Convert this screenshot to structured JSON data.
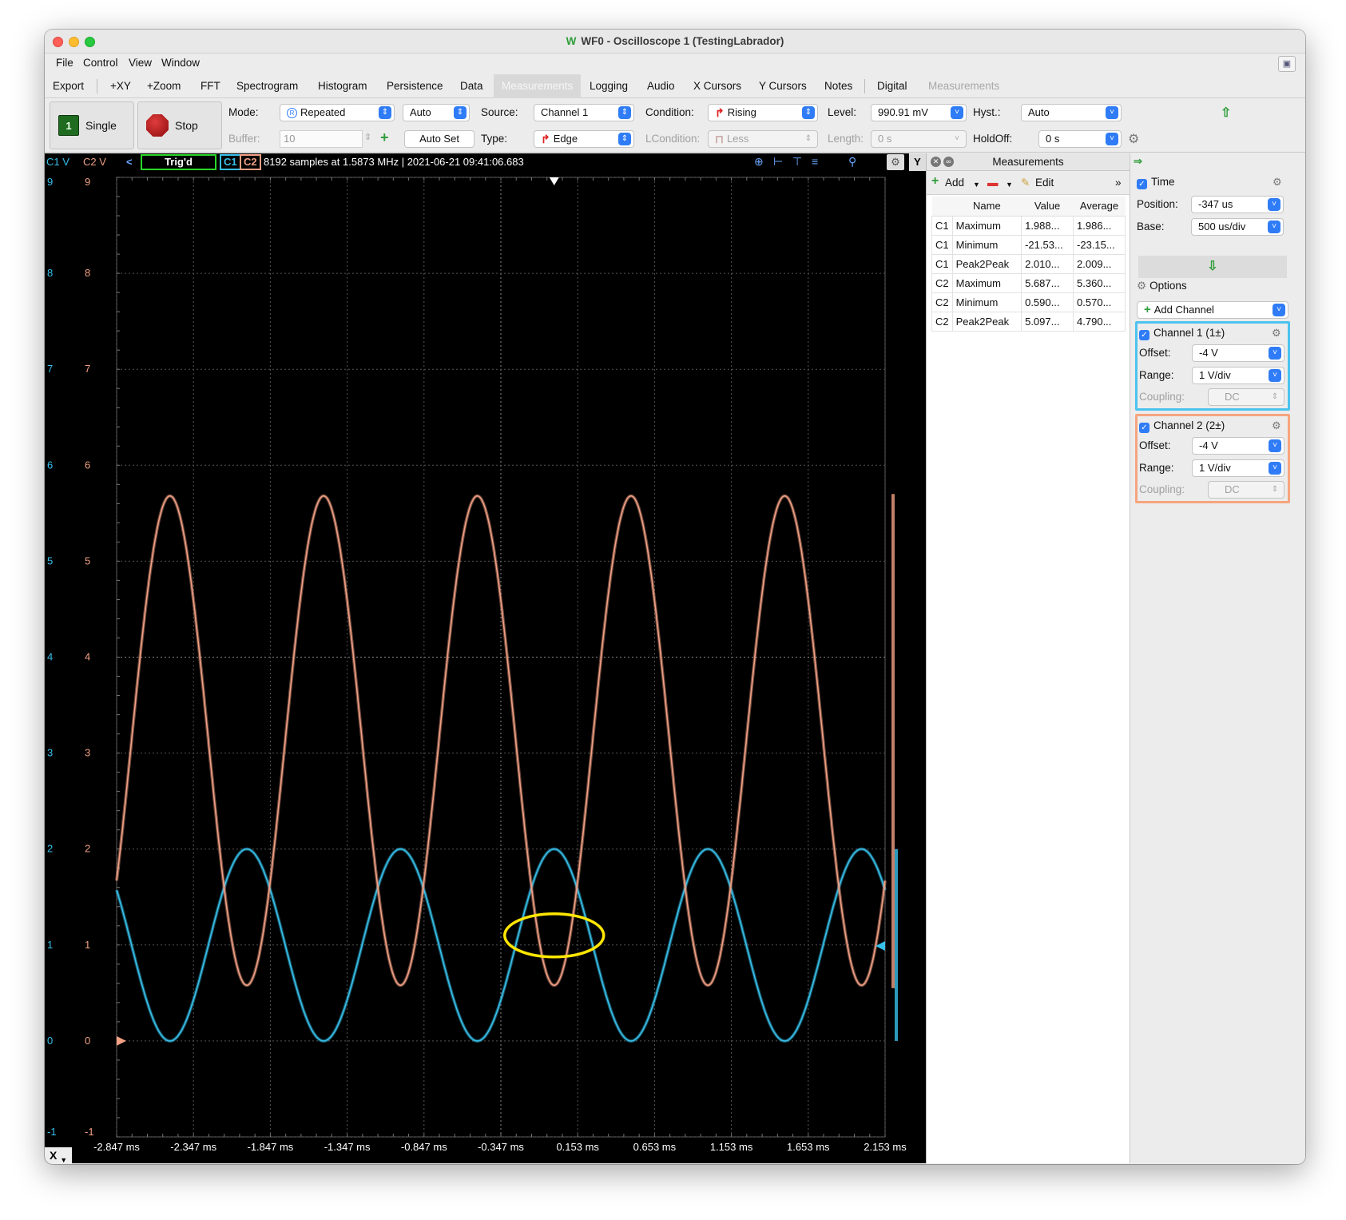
{
  "window": {
    "title": "WF0 - Oscilloscope 1 (TestingLabrador)",
    "logo": "W"
  },
  "menu": [
    "File",
    "Control",
    "View",
    "Window"
  ],
  "tabs": [
    {
      "label": "Export"
    },
    {
      "label": "+XY"
    },
    {
      "label": "+Zoom"
    },
    {
      "label": "FFT"
    },
    {
      "label": "Spectrogram"
    },
    {
      "label": "Histogram"
    },
    {
      "label": "Persistence"
    },
    {
      "label": "Data"
    },
    {
      "label": "Measurements",
      "active": true
    },
    {
      "label": "Logging"
    },
    {
      "label": "Audio"
    },
    {
      "label": "X Cursors"
    },
    {
      "label": "Y Cursors"
    },
    {
      "label": "Notes"
    },
    {
      "label": "Digital"
    },
    {
      "label": "Measurements",
      "disabled": true
    }
  ],
  "toolbar": {
    "single_label": "Single",
    "single_icon_text": "1",
    "stop_label": "Stop",
    "mode_label": "Mode:",
    "mode_value": "Repeated",
    "mode_icon": "R",
    "auto_value": "Auto",
    "source_label": "Source:",
    "source_value": "Channel 1",
    "condition_label": "Condition:",
    "condition_value": "Rising",
    "level_label": "Level:",
    "level_value": "990.91 mV",
    "hyst_label": "Hyst.:",
    "hyst_value": "Auto",
    "buffer_label": "Buffer:",
    "buffer_value": "10",
    "autoset_label": "Auto Set",
    "type_label": "Type:",
    "type_value": "Edge",
    "lcondition_label": "LCondition:",
    "lcondition_value": "Less",
    "length_label": "Length:",
    "length_value": "0 s",
    "holdoff_label": "HoldOff:",
    "holdoff_value": "0 s"
  },
  "scope": {
    "c1_axis_label": "C1 V",
    "c2_axis_label": "C2 V",
    "trig_status": "Trig'd",
    "c1_tag": "C1",
    "c2_tag": "C2",
    "info": "8192 samples at 1.5873 MHz | 2021-06-21 09:41:06.683",
    "y_button": "Y",
    "x_button": "X",
    "colors": {
      "c1": "#37c0ea",
      "c2": "#f1a084",
      "annotation": "#ffe600"
    }
  },
  "chart_data": {
    "type": "line",
    "x_ticks": [
      "-2.847 ms",
      "-2.347 ms",
      "-1.847 ms",
      "-1.347 ms",
      "-0.847 ms",
      "-0.347 ms",
      "0.153 ms",
      "0.653 ms",
      "1.153 ms",
      "1.653 ms",
      "2.153 ms"
    ],
    "xlim_ms": [
      -2.847,
      2.153
    ],
    "y_ticks": [
      9,
      8,
      7,
      6,
      5,
      4,
      3,
      2,
      1,
      0,
      -1
    ],
    "ylim": [
      -1,
      9
    ],
    "grid": true,
    "series": [
      {
        "name": "C1",
        "center": 1.0,
        "amplitude": 1.0,
        "period_ms": 1.0,
        "peak_at_ms": 0.0
      },
      {
        "name": "C2",
        "center": 3.13,
        "amplitude": 2.55,
        "period_ms": 1.0,
        "trough_at_ms": 0.0
      }
    ],
    "annotation": {
      "type": "ellipse",
      "center_ms": 0.0,
      "center_v": 1.1
    }
  },
  "measurements": {
    "title": "Measurements",
    "add_label": "Add",
    "edit_label": "Edit",
    "columns": [
      "",
      "Name",
      "Value",
      "Average"
    ],
    "rows": [
      [
        "C1",
        "Maximum",
        "1.988...",
        "1.986..."
      ],
      [
        "C1",
        "Minimum",
        "-21.53...",
        "-23.15..."
      ],
      [
        "C1",
        "Peak2Peak",
        "2.010...",
        "2.009..."
      ],
      [
        "C2",
        "Maximum",
        "5.687...",
        "5.360..."
      ],
      [
        "C2",
        "Minimum",
        "0.590...",
        "0.570..."
      ],
      [
        "C2",
        "Peak2Peak",
        "5.097...",
        "4.790..."
      ]
    ]
  },
  "side": {
    "time_label": "Time",
    "position_label": "Position:",
    "position_value": "-347 us",
    "base_label": "Base:",
    "base_value": "500 us/div",
    "options_label": "Options",
    "add_channel_label": "Add Channel",
    "ch1": {
      "title": "Channel 1 (1±)",
      "offset_label": "Offset:",
      "offset_value": "-4 V",
      "range_label": "Range:",
      "range_value": "1 V/div",
      "coupling_label": "Coupling:",
      "coupling_value": "DC",
      "color": "#4cc3ee"
    },
    "ch2": {
      "title": "Channel 2 (2±)",
      "offset_label": "Offset:",
      "offset_value": "-4 V",
      "range_label": "Range:",
      "range_value": "1 V/div",
      "coupling_label": "Coupling:",
      "coupling_value": "DC",
      "color": "#f6a57f"
    }
  }
}
